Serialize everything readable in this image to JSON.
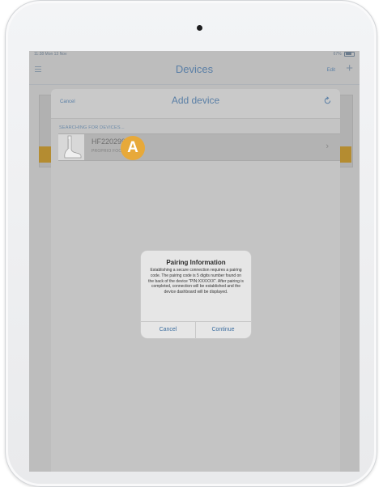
{
  "status_bar": {
    "time": "11:38 Mon 13 Nov",
    "battery": "67%"
  },
  "navbar": {
    "title": "Devices",
    "edit_label": "Edit",
    "add_label": "+"
  },
  "sheet": {
    "cancel_label": "Cancel",
    "title": "Add device",
    "section_label": "SEARCHING FOR DEVICES...",
    "device": {
      "name": "HF220299",
      "type": "PROPRIO FOOT®"
    }
  },
  "marker_label": "A",
  "dialog": {
    "title": "Pairing Information",
    "message": "Establishing a secure connection requires a pairing code. The pairing code is 5 digits number found on the back of the device \"PIN:XXXXXX\". After pairing is completed, connection will be established and the device dashboard will be displayed.",
    "cancel_label": "Cancel",
    "continue_label": "Continue"
  },
  "colors": {
    "accent": "#5a7fa6",
    "marker": "#e7a93a",
    "highlight": "#b48c31"
  },
  "icons": [
    "menu-icon",
    "add-icon",
    "refresh-icon",
    "chevron-right-icon",
    "foot-icon",
    "battery-icon"
  ]
}
